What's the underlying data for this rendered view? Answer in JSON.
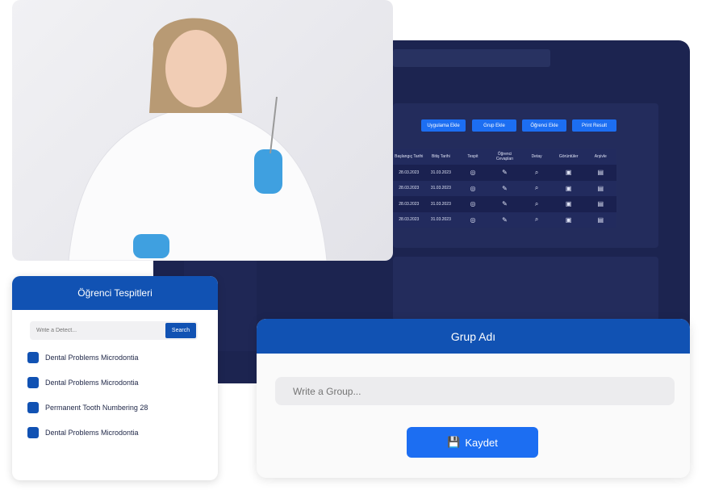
{
  "toolbar": {
    "buttons": [
      "Uygulama Ekle",
      "Grup Ekle",
      "Öğrenci Ekle",
      "Print Result"
    ]
  },
  "table": {
    "headers": [
      "Başlangıç Tarihi",
      "Bitiş Tarihi",
      "Tespit",
      "Öğrenci Cevapları",
      "Detay",
      "Görüntüler",
      "Arşivle"
    ],
    "rows": [
      {
        "start": "28.03.2023",
        "end": "31.03.2023"
      },
      {
        "start": "28.03.2023",
        "end": "31.03.2023"
      },
      {
        "start": "28.03.2023",
        "end": "31.03.2023"
      },
      {
        "start": "28.03.2023",
        "end": "31.03.2023"
      }
    ],
    "row_icons": [
      "tooth-scan-icon",
      "edit-document-icon",
      "search-icon",
      "image-icon",
      "archive-icon"
    ]
  },
  "detects": {
    "title": "Öğrenci Tespitleri",
    "placeholder": "Write a Detect...",
    "search_label": "Search",
    "items": [
      "Dental Problems Microdontia",
      "Dental Problems Microdontia",
      "Permanent Tooth Numbering 28",
      "Dental Problems Microdontia"
    ]
  },
  "group": {
    "title": "Grup Adı",
    "placeholder": "Write a Group...",
    "save_label": "Kaydet"
  },
  "colors": {
    "primary": "#1152b3",
    "accent": "#1c6ef2",
    "dark": "#1c2450"
  }
}
